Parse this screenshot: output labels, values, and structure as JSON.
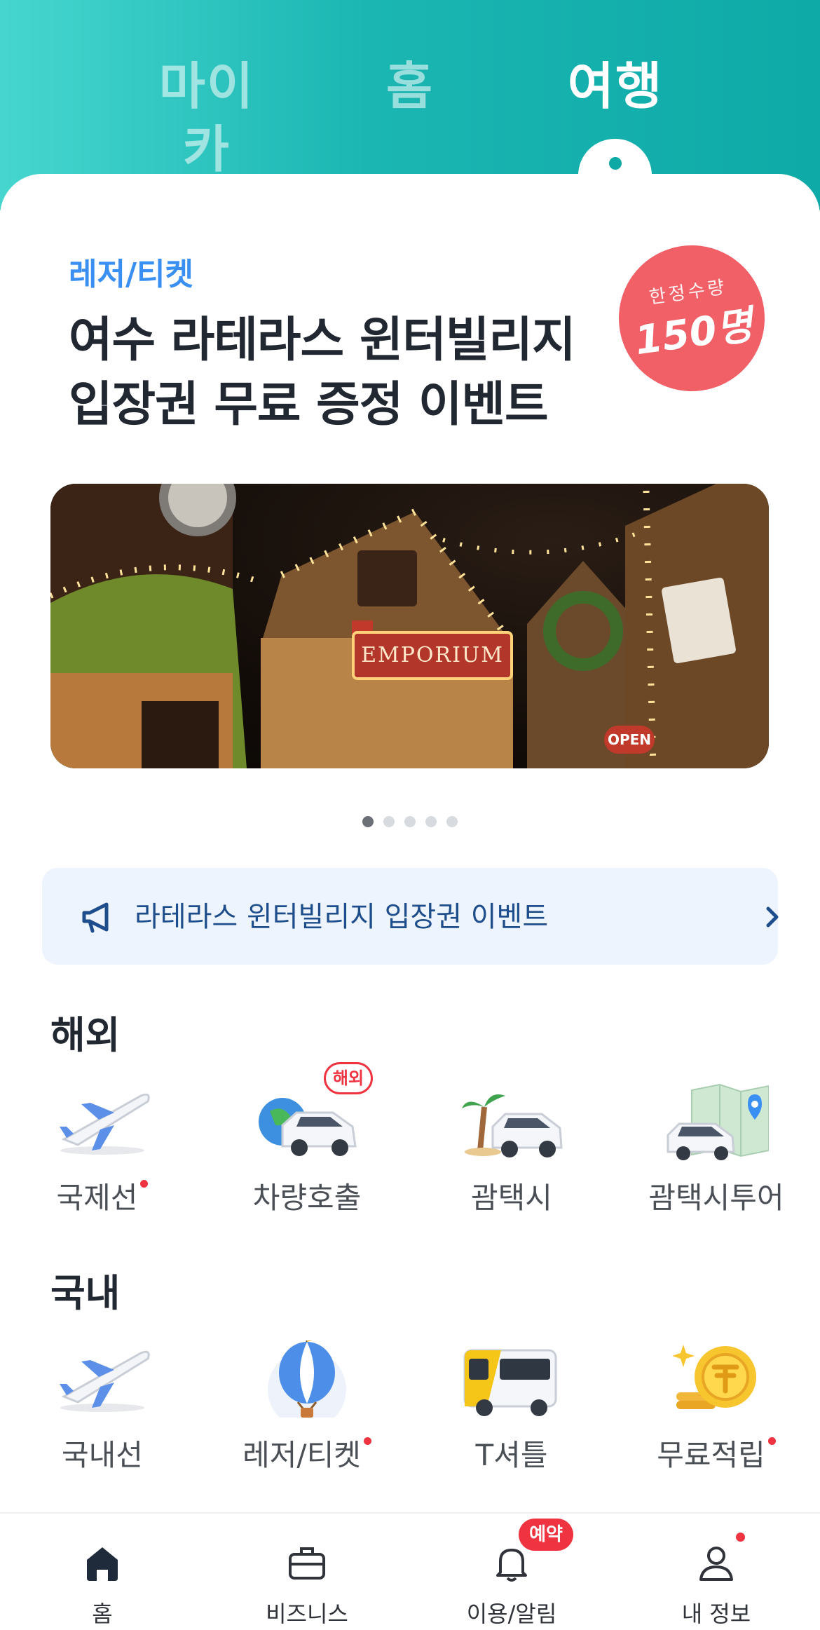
{
  "top_tabs": [
    {
      "label": "마이카",
      "active": false
    },
    {
      "label": "홈",
      "active": false
    },
    {
      "label": "여행",
      "active": true
    }
  ],
  "event": {
    "category": "레저/티켓",
    "title_line1": "여수 라테라스 윈터빌리지",
    "title_line2": "입장권 무료 증정 이벤트",
    "badge_sub": "한정수량",
    "badge_main": "150명",
    "hero_sign": "EMPORIUM",
    "hero_open_sign": "OPEN",
    "carousel": {
      "total": 5,
      "current": 1
    }
  },
  "notice": {
    "icon": "megaphone-icon",
    "text": "라테라스 윈터빌리지 입장권 이벤트"
  },
  "overseas": {
    "title": "해외",
    "items": [
      {
        "label": "국제선",
        "icon": "airplane-icon",
        "new_dot": true
      },
      {
        "label": "차량호출",
        "icon": "car-globe-icon",
        "new_dot": false,
        "bubble": "해외"
      },
      {
        "label": "괌택시",
        "icon": "palm-car-icon",
        "new_dot": false
      },
      {
        "label": "괌택시투어",
        "icon": "map-car-icon",
        "new_dot": false
      }
    ]
  },
  "domestic": {
    "title": "국내",
    "items": [
      {
        "label": "국내선",
        "icon": "airplane-icon",
        "new_dot": false
      },
      {
        "label": "레저/티켓",
        "icon": "hot-air-balloon-icon",
        "new_dot": true
      },
      {
        "label": "T셔틀",
        "icon": "shuttle-bus-icon",
        "new_dot": false
      },
      {
        "label": "무료적립",
        "icon": "coin-icon",
        "new_dot": true
      }
    ]
  },
  "bottom_nav": [
    {
      "label": "홈",
      "icon": "home-icon",
      "active": true
    },
    {
      "label": "비즈니스",
      "icon": "briefcase-icon",
      "active": false
    },
    {
      "label": "이용/알림",
      "icon": "bell-icon",
      "active": false,
      "badge": "예약"
    },
    {
      "label": "내 정보",
      "icon": "profile-icon",
      "active": false,
      "dot": true
    }
  ],
  "colors": {
    "header_teal": "#1bb6b2",
    "accent_blue": "#3a8ff2",
    "badge_red": "#f15f67",
    "alert_red": "#ef3340",
    "notice_bg": "#eef4fd"
  }
}
